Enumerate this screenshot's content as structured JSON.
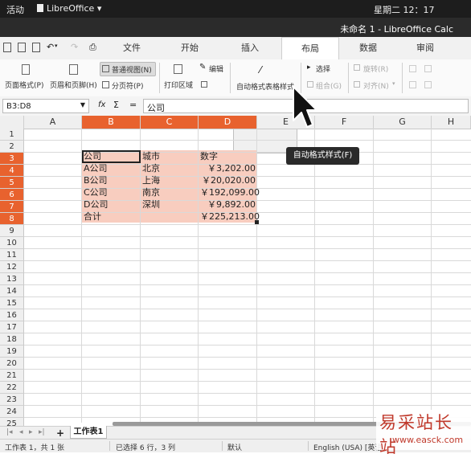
{
  "gnome": {
    "activities": "活动",
    "app_name": "LibreOffice ▾",
    "clock": "星期二 12：17"
  },
  "window": {
    "title": "未命名 1 - LibreOffice Calc"
  },
  "tabs": [
    "文件",
    "开始",
    "插入",
    "布局",
    "数据",
    "审阅"
  ],
  "active_tab": "布局",
  "ribbon": {
    "page_format": "页面格式(P)",
    "header_footer": "页眉和页脚(H)",
    "normal_view": "普通视图(N)",
    "page_break": "分页符(P)",
    "print_range": "打印区域",
    "edit": "编辑",
    "autoformat": "自动格式表格样式",
    "select": "选择",
    "group": "组合(G)",
    "rotate": "旋转(R)",
    "align": "对齐(N)"
  },
  "formula": {
    "name_box": "B3:D8",
    "fx": "fx",
    "sigma": "Σ",
    "equals": "=",
    "content": "公司"
  },
  "grid": {
    "columns": [
      "A",
      "B",
      "C",
      "D",
      "E",
      "F",
      "G",
      "H"
    ],
    "selected_columns": [
      "B",
      "C",
      "D"
    ],
    "rows": [
      "1",
      "2",
      "3",
      "4",
      "5",
      "6",
      "7",
      "8",
      "9",
      "10",
      "11",
      "12",
      "13",
      "14",
      "15",
      "16",
      "17",
      "18",
      "19",
      "20",
      "21",
      "22",
      "23",
      "24",
      "25"
    ],
    "selected_rows": [
      "3",
      "4",
      "5",
      "6",
      "7",
      "8"
    ],
    "table": [
      [
        "公司",
        "城市",
        "数字"
      ],
      [
        "A公司",
        "北京",
        "￥3,202.00"
      ],
      [
        "B公司",
        "上海",
        "￥20,020.00"
      ],
      [
        "C公司",
        "南京",
        "￥192,099.00"
      ],
      [
        "D公司",
        "深圳",
        "￥9,892.00"
      ],
      [
        "合计",
        "",
        "￥225,213.00"
      ]
    ],
    "selection_color": "#f8cdbf",
    "header_highlight_color": "#e8622e"
  },
  "tooltip": "自动格式样式(F)",
  "sheet": {
    "tab_label": "工作表1",
    "add": "+"
  },
  "status": {
    "sheet_info": "工作表 1，共 1 张",
    "selection": "已选择 6 行，3 列",
    "style": "默认",
    "language": "English (USA)",
    "language_tail": "英语"
  },
  "watermark": {
    "logo": "易采站长站",
    "url": "www.easck.com"
  }
}
